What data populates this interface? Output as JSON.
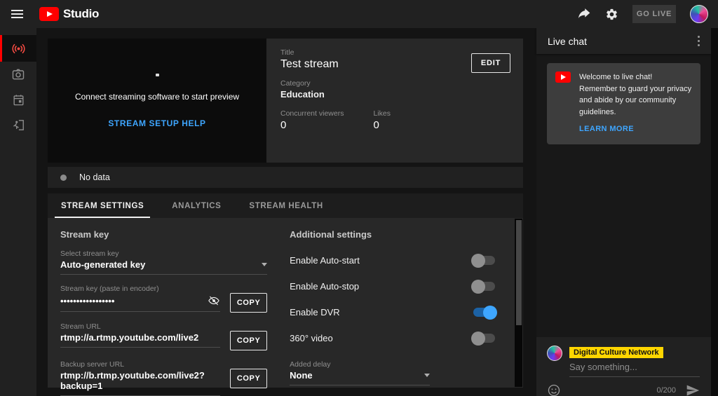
{
  "colors": {
    "brand_red": "#ff0000",
    "accent_blue": "#3ea6ff",
    "badge_yellow": "#ffd600",
    "toggle_on": "#3ea6ff"
  },
  "icons": {
    "menu-icon": "hamburger bars",
    "youtube-logo-icon": "red rounded play button",
    "share-icon": "curved forward arrow",
    "settings-gear-icon": "gear",
    "stream-broadcast-icon": "dot with radio waves",
    "webcam-icon": "camera",
    "manage-calendar-icon": "calendar",
    "exit-live-icon": "person exiting door",
    "visibility-off-icon": "eye with slash",
    "dropdown-caret-icon": "down triangle",
    "kebab-menu-icon": "three vertical dots",
    "emoji-icon": "smiley face",
    "send-icon": "paper plane arrow",
    "status-dot-icon": "gray circle"
  },
  "topbar": {
    "product": "Studio",
    "go_live_label": "GO LIVE"
  },
  "preview": {
    "message": "Connect streaming software to start preview",
    "help_link": "STREAM SETUP HELP"
  },
  "stream_info": {
    "title_label": "Title",
    "title": "Test stream",
    "category_label": "Category",
    "category": "Education",
    "viewers_label": "Concurrent viewers",
    "viewers": "0",
    "likes_label": "Likes",
    "likes": "0",
    "edit_label": "EDIT"
  },
  "status": {
    "no_data": "No data"
  },
  "tabs": [
    {
      "label": "STREAM SETTINGS",
      "active": true
    },
    {
      "label": "ANALYTICS",
      "active": false
    },
    {
      "label": "STREAM HEALTH",
      "active": false
    }
  ],
  "stream_key": {
    "section_title": "Stream key",
    "select_label": "Select stream key",
    "select_value": "Auto-generated key",
    "key_label": "Stream key (paste in encoder)",
    "key_masked": "•••••••••••••••••",
    "copy_label": "COPY",
    "url_label": "Stream URL",
    "url_value": "rtmp://a.rtmp.youtube.com/live2",
    "backup_label": "Backup server URL",
    "backup_value": "rtmp://b.rtmp.youtube.com/live2?backup=1"
  },
  "additional": {
    "section_title": "Additional settings",
    "toggles": [
      {
        "label": "Enable Auto-start",
        "on": false
      },
      {
        "label": "Enable Auto-stop",
        "on": false
      },
      {
        "label": "Enable DVR",
        "on": true
      },
      {
        "label": "360° video",
        "on": false
      }
    ],
    "delay_label": "Added delay",
    "delay_value": "None"
  },
  "chat": {
    "header": "Live chat",
    "welcome": "Welcome to live chat! Remember to guard your privacy and abide by our community guidelines.",
    "learn_more": "LEARN MORE",
    "username": "Digital Culture Network",
    "placeholder": "Say something...",
    "counter": "0/200"
  }
}
